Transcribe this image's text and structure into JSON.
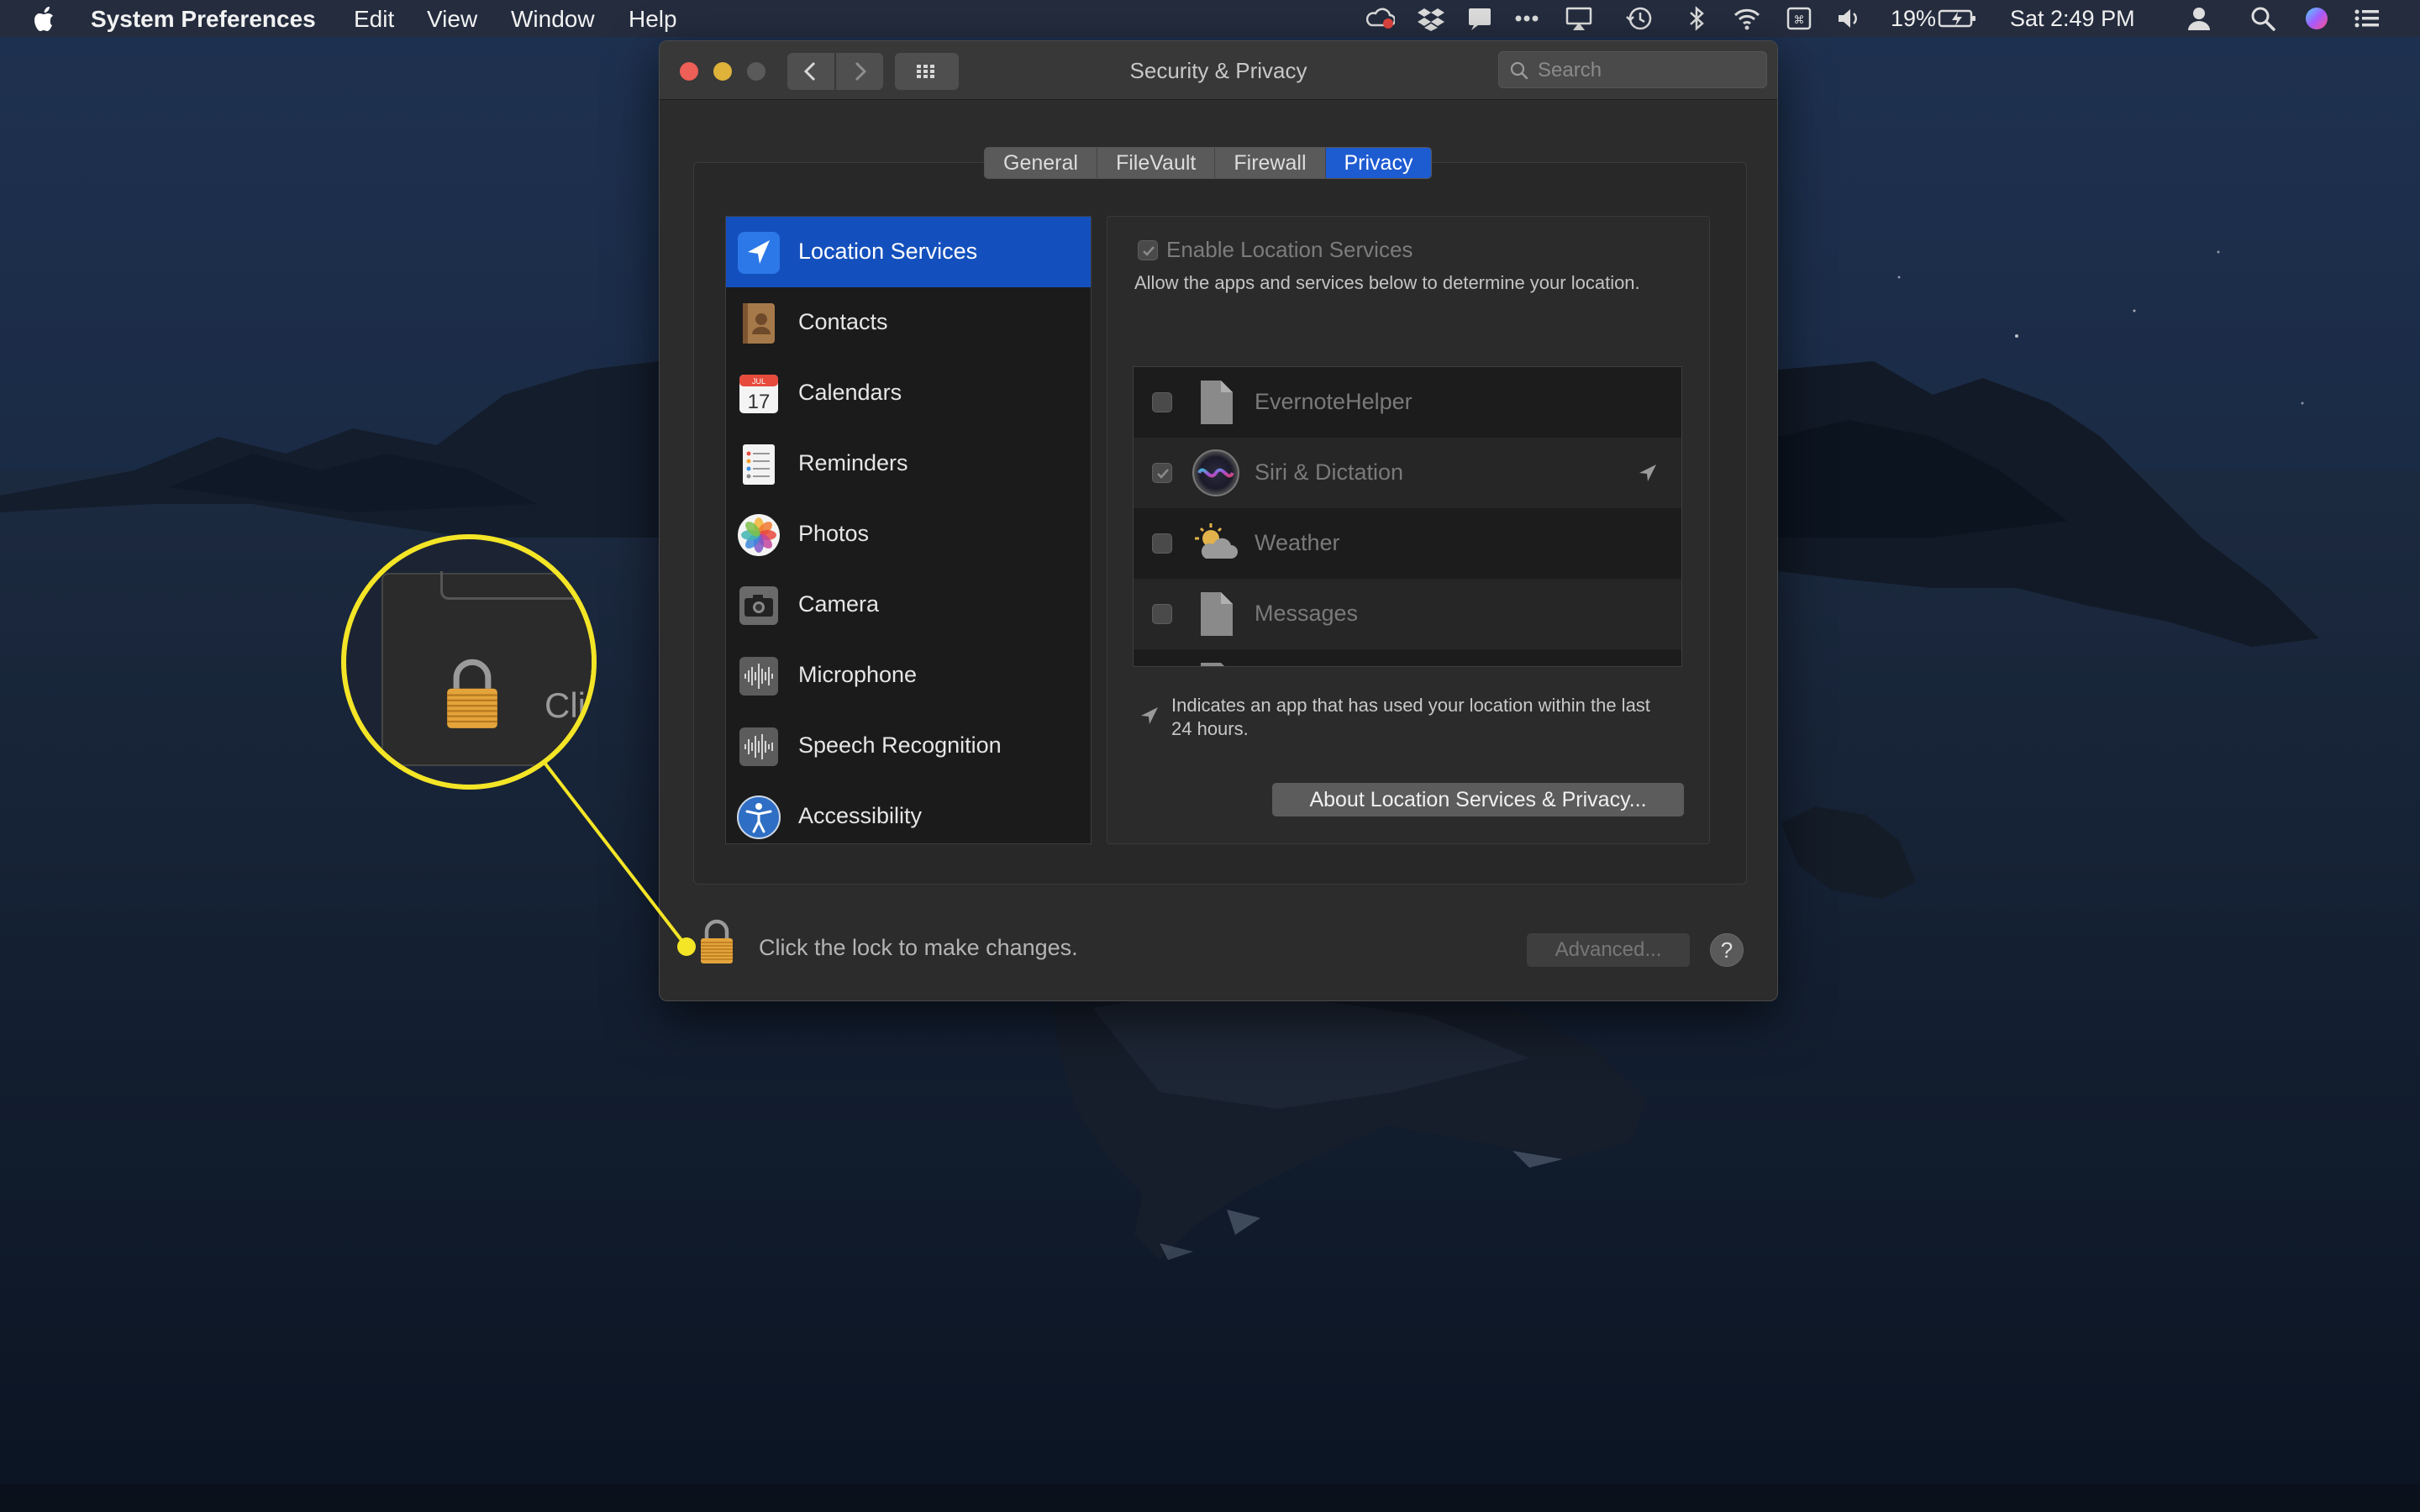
{
  "menubar": {
    "app_name": "System Preferences",
    "menus": [
      "Edit",
      "View",
      "Window",
      "Help"
    ],
    "battery_percent": "19%",
    "clock": "Sat 2:49 PM",
    "status_icons": [
      "creative-cloud-icon",
      "dropbox-icon",
      "notification-icon",
      "more-dots-icon",
      "airplay-icon",
      "time-machine-icon",
      "bluetooth-icon",
      "wifi-icon",
      "input-source-icon",
      "volume-icon",
      "battery-icon",
      "user-icon",
      "spotlight-icon",
      "siri-icon",
      "notification-center-icon"
    ]
  },
  "window": {
    "title": "Security & Privacy",
    "search_placeholder": "Search",
    "tabs": [
      {
        "label": "General",
        "active": false
      },
      {
        "label": "FileVault",
        "active": false
      },
      {
        "label": "Firewall",
        "active": false
      },
      {
        "label": "Privacy",
        "active": true
      }
    ],
    "sidebar": [
      {
        "label": "Location Services",
        "icon": "location-arrow-icon",
        "selected": true
      },
      {
        "label": "Contacts",
        "icon": "contacts-icon",
        "selected": false
      },
      {
        "label": "Calendars",
        "icon": "calendar-icon",
        "selected": false
      },
      {
        "label": "Reminders",
        "icon": "reminders-icon",
        "selected": false
      },
      {
        "label": "Photos",
        "icon": "photos-icon",
        "selected": false
      },
      {
        "label": "Camera",
        "icon": "camera-icon",
        "selected": false
      },
      {
        "label": "Microphone",
        "icon": "microphone-icon",
        "selected": false
      },
      {
        "label": "Speech Recognition",
        "icon": "speech-recognition-icon",
        "selected": false
      },
      {
        "label": "Accessibility",
        "icon": "accessibility-icon",
        "selected": false
      }
    ],
    "calendar_icon_month": "JUL",
    "calendar_icon_day": "17",
    "location": {
      "enable_label": "Enable Location Services",
      "enable_checked": true,
      "description": "Allow the apps and services below to determine your location.",
      "apps": [
        {
          "name": "EvernoteHelper",
          "checked": false,
          "recent": false
        },
        {
          "name": "Siri & Dictation",
          "checked": true,
          "recent": true
        },
        {
          "name": "Weather",
          "checked": false,
          "recent": false
        },
        {
          "name": "Messages",
          "checked": false,
          "recent": false
        }
      ],
      "legend": "Indicates an app that has used your location within the last 24 hours.",
      "about_button": "About Location Services & Privacy..."
    },
    "lock_text": "Click the lock to make changes.",
    "advanced_button": "Advanced...",
    "help_button": "?"
  },
  "callout": {
    "text": "Clic",
    "highlight_color": "#f4e526"
  },
  "colors": {
    "accent": "#1450bd",
    "tab_active": "#1d5bd1"
  }
}
